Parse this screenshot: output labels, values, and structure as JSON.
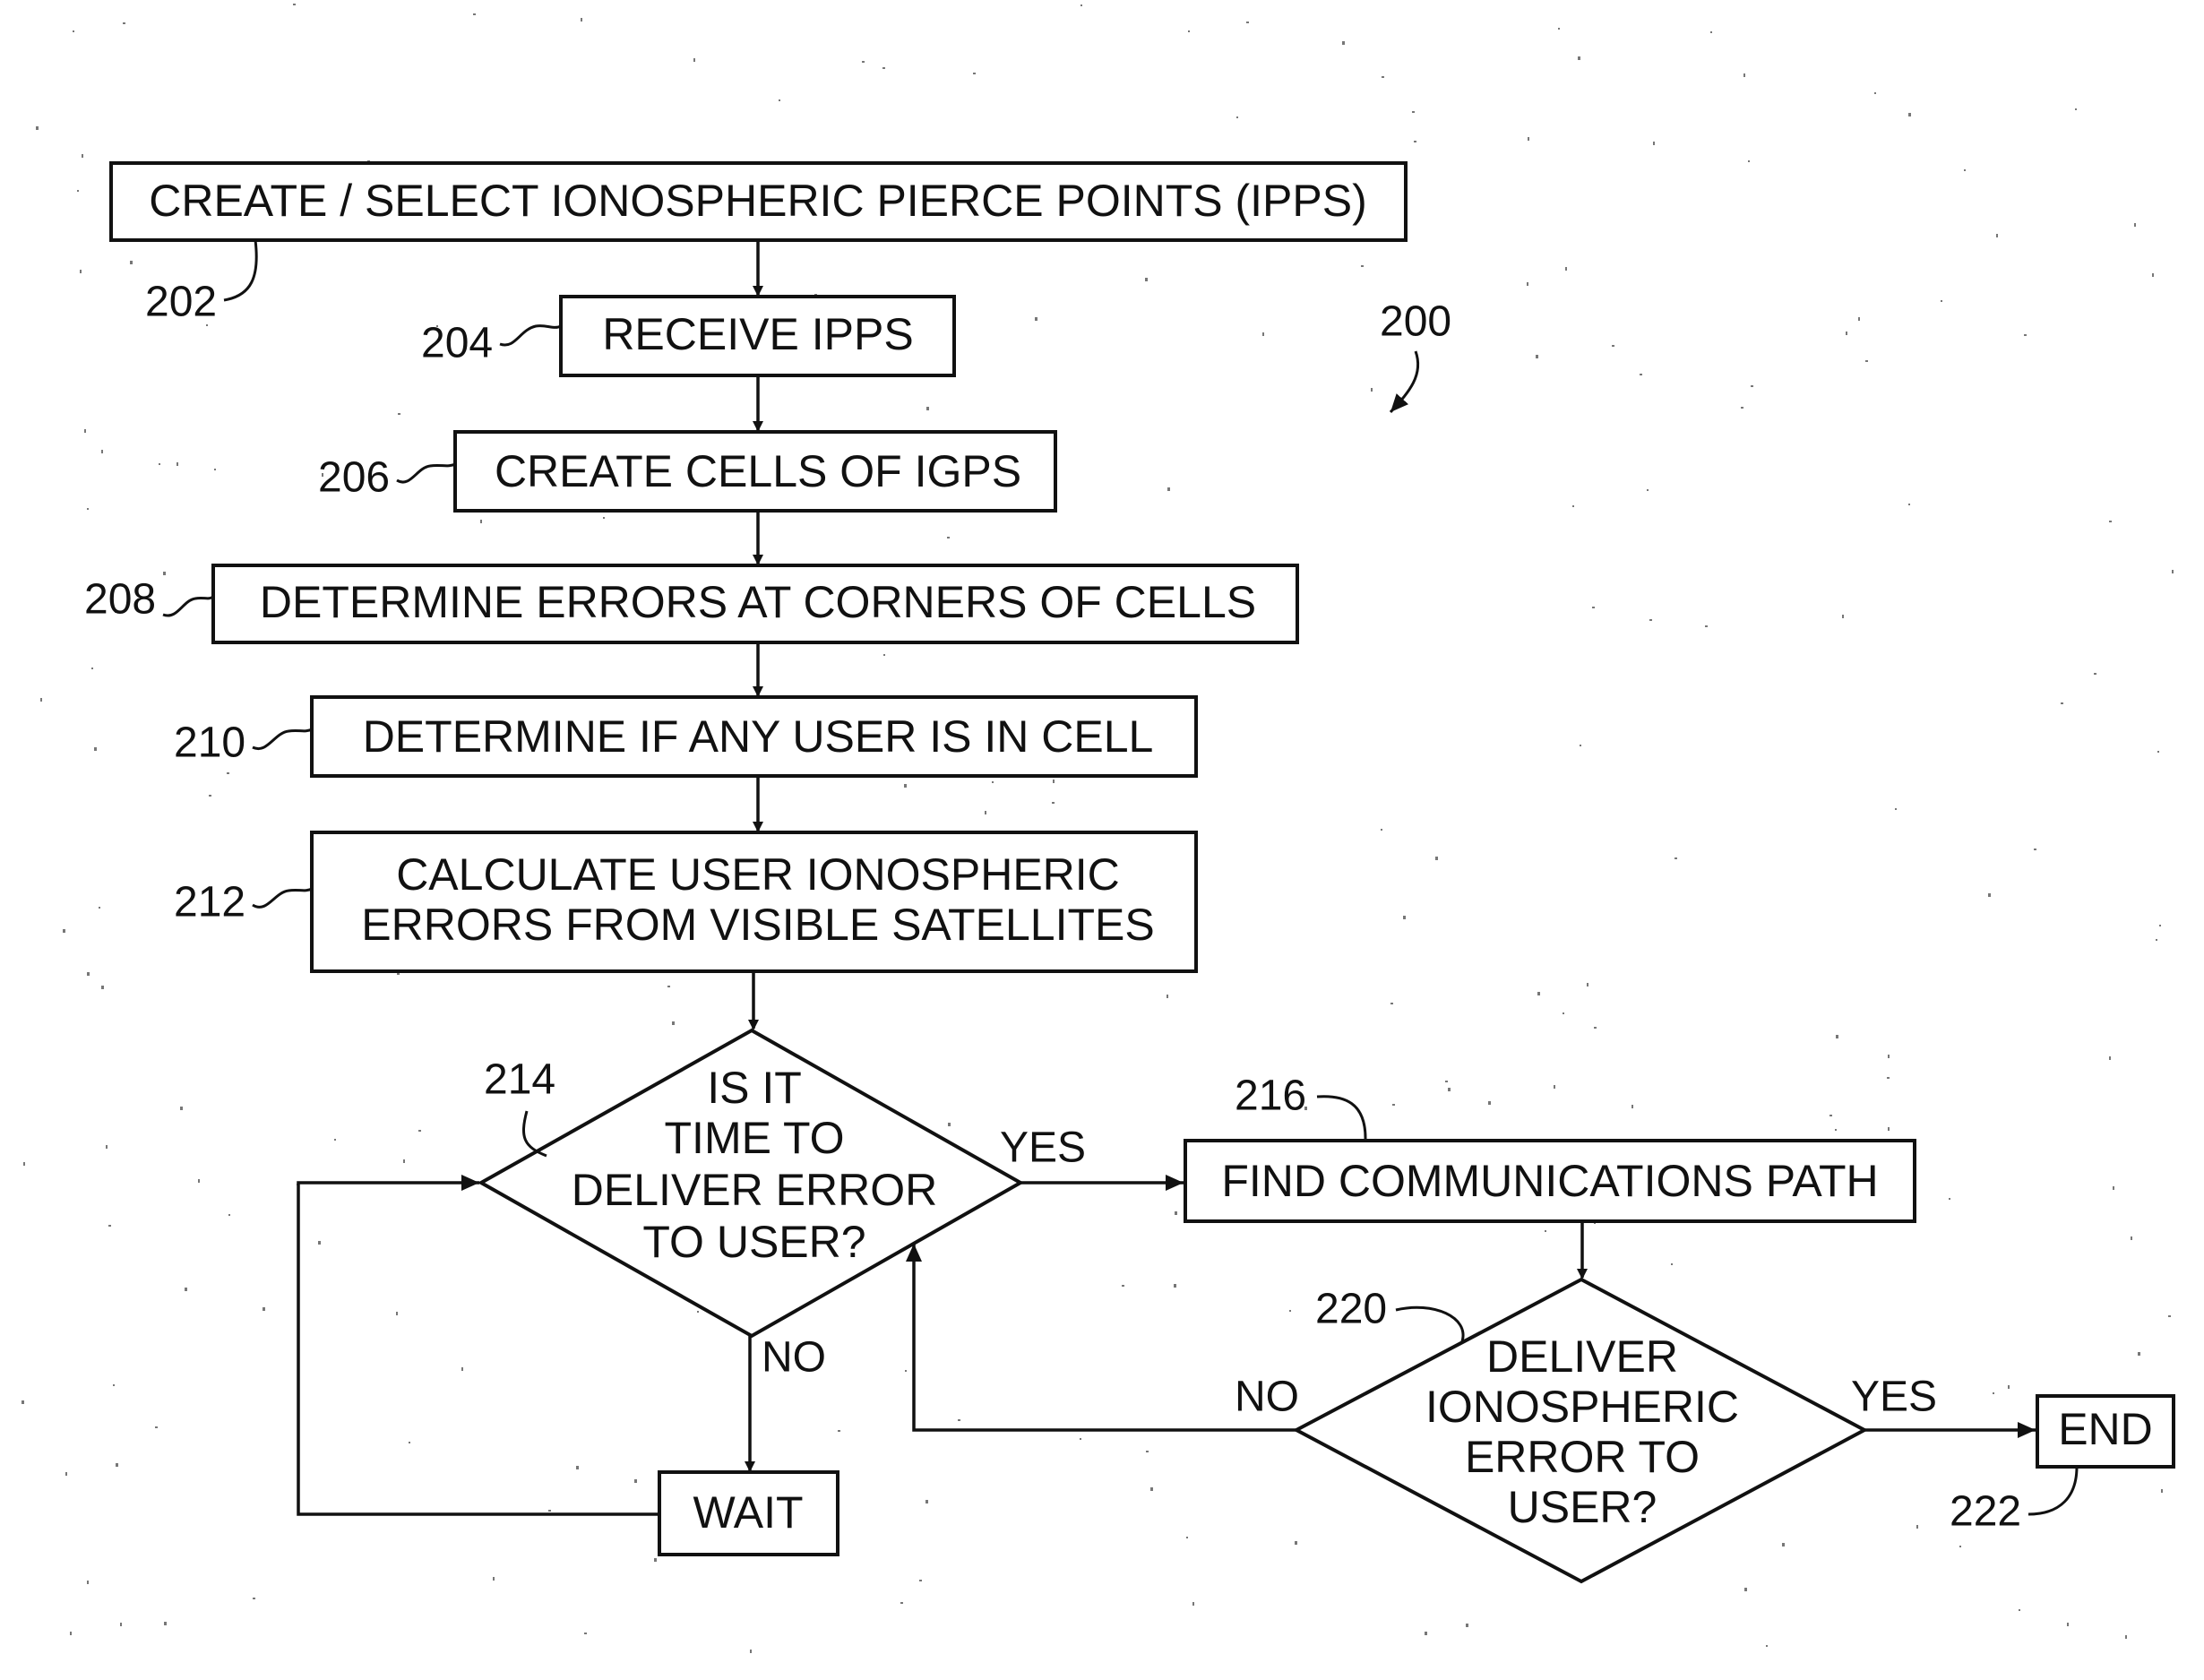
{
  "figure": {
    "ref_number": "200",
    "steps": {
      "s202": {
        "ref": "202",
        "lines": [
          "CREATE / SELECT IONOSPHERIC PIERCE POINTS (IPPS)"
        ]
      },
      "s204": {
        "ref": "204",
        "lines": [
          "RECEIVE IPPS"
        ]
      },
      "s206": {
        "ref": "206",
        "lines": [
          "CREATE CELLS OF IGPS"
        ]
      },
      "s208": {
        "ref": "208",
        "lines": [
          "DETERMINE ERRORS AT CORNERS OF CELLS"
        ]
      },
      "s210": {
        "ref": "210",
        "lines": [
          "DETERMINE IF ANY USER IS IN CELL"
        ]
      },
      "s212": {
        "ref": "212",
        "lines": [
          "CALCULATE USER IONOSPHERIC",
          "ERRORS FROM VISIBLE SATELLITES"
        ]
      },
      "s214": {
        "ref": "214",
        "lines": [
          "IS IT",
          "TIME TO",
          "DELIVER ERROR",
          "TO USER?"
        ]
      },
      "s216": {
        "ref": "216",
        "lines": [
          "FIND COMMUNICATIONS PATH"
        ]
      },
      "s220": {
        "ref": "220",
        "lines": [
          "DELIVER",
          "IONOSPHERIC",
          "ERROR TO",
          "USER?"
        ]
      },
      "s222": {
        "ref": "222",
        "lines": [
          "END"
        ]
      },
      "wait": {
        "lines": [
          "WAIT"
        ]
      }
    },
    "branches": {
      "d214_yes": "YES",
      "d214_no": "NO",
      "d220_yes": "YES",
      "d220_no": "NO"
    }
  }
}
